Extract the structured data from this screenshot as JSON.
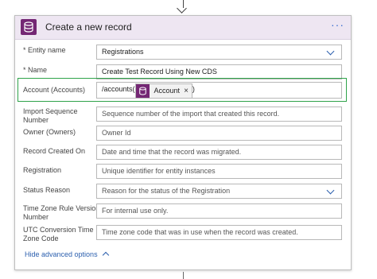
{
  "header": {
    "title": "Create a new record",
    "menu": "···"
  },
  "fields": [
    {
      "label": "* Entity name",
      "value": "Registrations",
      "type": "dropdown"
    },
    {
      "label": "* Name",
      "value": "Create Test Record Using New CDS",
      "type": "text"
    },
    {
      "label": "Account (Accounts)",
      "value_prefix": "/accounts(",
      "token": "Account",
      "token_close": "×",
      "value_suffix": ")",
      "type": "token"
    },
    {
      "label": "Import Sequence Number",
      "placeholder": "Sequence number of the import that created this record.",
      "type": "text"
    },
    {
      "label": "Owner (Owners)",
      "placeholder": "Owner Id",
      "type": "text"
    },
    {
      "label": "Record Created On",
      "placeholder": "Date and time that the record was migrated.",
      "type": "text"
    },
    {
      "label": "Registration",
      "placeholder": "Unique identifier for entity instances",
      "type": "text"
    },
    {
      "label": "Status Reason",
      "placeholder": "Reason for the status of the Registration",
      "type": "dropdown"
    },
    {
      "label": "Time Zone Rule Version Number",
      "placeholder": "For internal use only.",
      "type": "text"
    },
    {
      "label": "UTC Conversion Time Zone Code",
      "placeholder": "Time zone code that was in use when the record was created.",
      "type": "text"
    }
  ],
  "advanced_link": "Hide advanced options",
  "colors": {
    "accent": "#742774",
    "header_bg": "#eee6f2",
    "link": "#2b5fae",
    "highlight": "#2fa34a"
  }
}
